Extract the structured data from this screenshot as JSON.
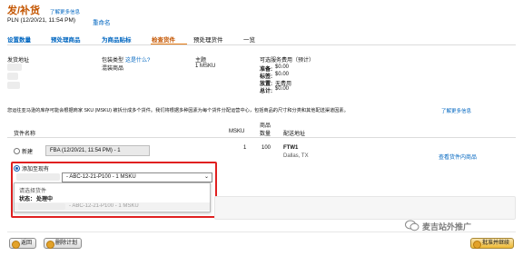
{
  "header": {
    "title": "发/补货",
    "learn_more": "了解更多信息",
    "plan_name": "PLN (12/20/21, 11:54 PM)",
    "rename": "重命名"
  },
  "tabs": [
    {
      "label": "设置数量"
    },
    {
      "label": "预处理商品"
    },
    {
      "label": "为商品贴标"
    },
    {
      "label": "检查货件"
    },
    {
      "label": "预处理货件"
    },
    {
      "label": "一览"
    }
  ],
  "summary": {
    "ship_from_label": "发货地址",
    "packing_type_label": "包装类型",
    "packing_type_link": "这是什么?",
    "packing_type_value": "混装商品",
    "subject_label": "主题",
    "subject_value": "1 MSKU",
    "fees_label": "可选服务费用（预计）",
    "fees": [
      {
        "label": "准备:",
        "value": "$0.00"
      },
      {
        "label": "标签:",
        "value": "$0.00"
      },
      {
        "label": "放置:",
        "value": "无费用"
      },
      {
        "label": "总计:",
        "value": "$0.00"
      }
    ]
  },
  "notice": {
    "text": "您运往亚马逊的库存可能会根据商家 SKU (MSKU) 被拆分成多个货件。我们将根据多种因素为每个货件分配运营中心，包括商品的尺寸和分类和其他配送渠道因素。",
    "link": "了解更多信息"
  },
  "table": {
    "col_name": "货件名称",
    "col_msku": "MSKU",
    "col_units_line1": "商品",
    "col_units_line2": "数量",
    "col_ship_to": "配送地址"
  },
  "row1": {
    "radio_label": "新建",
    "shipment_name": "FBA (12/20/21, 11:54 PM) - 1",
    "msku": "1",
    "units": "100",
    "fc": "FTW1",
    "city": "Dallas, TX",
    "view_link": "查看货件内商品"
  },
  "row2": {
    "radio_label": "添加至现有",
    "select_value": "- ABC-12-21-P100 - 1 MSKU",
    "dropdown_hint": "请选择货件",
    "status_label": "状态：",
    "status_value": "处理中",
    "faded_option": "- ABC-12-21-P100 - 1 MSKU"
  },
  "footer": {
    "back": "返回",
    "delete": "删除计划",
    "approve": "批准并继续"
  },
  "watermark": "麦吉站外推广"
}
